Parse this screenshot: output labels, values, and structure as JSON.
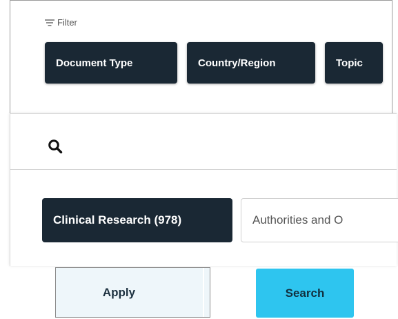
{
  "filter": {
    "label": "Filter",
    "icon": "filter-lines-icon",
    "chips": [
      {
        "label": "Document Type"
      },
      {
        "label": "Country/Region"
      },
      {
        "label": "Topic"
      }
    ]
  },
  "search": {
    "icon": "search-icon"
  },
  "results": {
    "chips": [
      {
        "label": "Clinical Research (978)",
        "active": true
      },
      {
        "label": "Authorities and O",
        "active": false
      }
    ]
  },
  "actions": {
    "apply_label": "Apply",
    "search_label": "Search"
  },
  "colors": {
    "chip_dark": "#1a2834",
    "search_button": "#2ec5ef",
    "apply_bg": "#eef6fa"
  }
}
